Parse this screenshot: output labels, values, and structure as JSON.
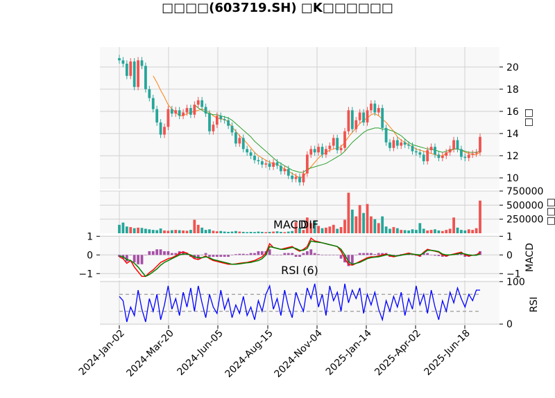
{
  "chart_data": {
    "type": "candlestick",
    "title": "□□□□(603719.SH) □K□□□□□□",
    "x_ticks": [
      "2024-Jan-02",
      "2024-Mar-20",
      "2024-Jun-05",
      "2024-Aug-15",
      "2024-Nov-04",
      "2025-Jan-14",
      "2025-Apr-02",
      "2025-Jun-18"
    ],
    "price_panel": {
      "ylabel": "□□",
      "yticks": [
        10,
        12,
        14,
        16,
        18,
        20
      ],
      "ylim": [
        9,
        21.8
      ],
      "candle_up_color": "#ef5350",
      "candle_down_color": "#26a69a",
      "ma_colors": [
        "#ff7f0e",
        "#2ca02c"
      ],
      "close": [
        20.6,
        20.3,
        19.2,
        20.5,
        18.2,
        20.6,
        20.1,
        18.0,
        17.2,
        16.2,
        15.0,
        13.9,
        14.6,
        16.2,
        15.8,
        16.1,
        15.6,
        15.9,
        16.3,
        15.7,
        16.6,
        17.0,
        16.4,
        15.8,
        14.2,
        14.8,
        15.6,
        15.3,
        15.2,
        14.7,
        14.1,
        13.1,
        13.6,
        12.6,
        12.3,
        12.0,
        11.6,
        11.5,
        11.2,
        11.3,
        11.0,
        11.4,
        11.1,
        10.6,
        10.8,
        10.2,
        9.9,
        10.1,
        9.6,
        10.4,
        12.1,
        12.6,
        12.3,
        12.8,
        12.1,
        12.6,
        12.9,
        13.6,
        12.5,
        12.7,
        14.2,
        16.1,
        14.4,
        15.2,
        15.9,
        15.0,
        16.1,
        16.7,
        15.9,
        16.3,
        14.5,
        13.2,
        12.7,
        13.4,
        12.9,
        13.2,
        13.0,
        12.9,
        12.4,
        12.3,
        12.1,
        11.5,
        12.5,
        12.8,
        12.1,
        11.8,
        12.0,
        12.3,
        12.6,
        13.4,
        12.6,
        11.9,
        11.8,
        12.1,
        12.2,
        12.3,
        13.7
      ],
      "ma_short": [
        null,
        null,
        null,
        null,
        null,
        null,
        null,
        null,
        null,
        19.2,
        18.6,
        17.9,
        17.3,
        16.6,
        16.2,
        15.9,
        15.6,
        15.6,
        15.8,
        15.9,
        16.0,
        16.1,
        16.2,
        16.1,
        15.9,
        15.6,
        15.4,
        15.3,
        15.3,
        15.0,
        14.6,
        14.2,
        13.8,
        13.5,
        13.1,
        12.7,
        12.3,
        12.0,
        11.8,
        11.6,
        11.4,
        11.3,
        11.2,
        11.0,
        10.8,
        10.6,
        10.4,
        10.2,
        10.0,
        10.1,
        10.6,
        11.0,
        11.4,
        11.8,
        12.1,
        12.3,
        12.5,
        12.6,
        12.7,
        12.8,
        13.2,
        13.7,
        14.1,
        14.5,
        14.9,
        15.2,
        15.4,
        15.7,
        15.8,
        15.6,
        15.3,
        15.0,
        14.6,
        14.2,
        13.7,
        13.4,
        13.2,
        13.0,
        12.8,
        12.6,
        12.5,
        12.4,
        12.3,
        12.2,
        12.1,
        12.0,
        12.0,
        12.2,
        12.4,
        12.6,
        12.6,
        12.5,
        12.3,
        12.2,
        12.1,
        12.1,
        12.3
      ],
      "ma_long": [
        null,
        null,
        null,
        null,
        null,
        null,
        null,
        null,
        null,
        null,
        null,
        null,
        null,
        null,
        null,
        null,
        null,
        null,
        null,
        null,
        16.6,
        16.3,
        16.1,
        15.9,
        15.8,
        15.7,
        15.7,
        15.6,
        15.5,
        15.4,
        15.2,
        14.9,
        14.6,
        14.3,
        14.0,
        13.7,
        13.3,
        13.0,
        12.7,
        12.4,
        12.1,
        11.8,
        11.5,
        11.3,
        11.1,
        10.9,
        10.7,
        10.6,
        10.5,
        10.5,
        10.8,
        10.9,
        11.0,
        11.1,
        11.2,
        11.3,
        11.5,
        11.7,
        11.9,
        12.1,
        12.4,
        12.8,
        13.2,
        13.5,
        13.8,
        14.1,
        14.3,
        14.4,
        14.5,
        14.5,
        14.4,
        14.4,
        14.3,
        14.2,
        14.0,
        13.8,
        13.5,
        13.2,
        13.0,
        12.9,
        12.8,
        12.7,
        12.6,
        12.6,
        12.5,
        12.4,
        12.3,
        12.4,
        12.5,
        12.6,
        12.6,
        12.5,
        12.4,
        12.3,
        12.3,
        12.3,
        12.4
      ]
    },
    "volume_panel": {
      "ylabel": "□□□",
      "yticks": [
        250000,
        500000,
        750000
      ],
      "ylim": [
        0,
        750000
      ],
      "values": [
        150000,
        190000,
        120000,
        110000,
        90000,
        100000,
        95000,
        80000,
        70000,
        60000,
        55000,
        85000,
        50000,
        45000,
        55000,
        60000,
        55000,
        50000,
        45000,
        60000,
        240000,
        150000,
        100000,
        60000,
        70000,
        45000,
        35000,
        40000,
        30000,
        25000,
        30000,
        40000,
        30000,
        25000,
        20000,
        25000,
        22000,
        30000,
        25000,
        20000,
        25000,
        30000,
        35000,
        25000,
        20000,
        30000,
        40000,
        200000,
        90000,
        60000,
        280000,
        180000,
        220000,
        130000,
        90000,
        100000,
        120000,
        150000,
        80000,
        110000,
        240000,
        720000,
        420000,
        300000,
        500000,
        360000,
        520000,
        300000,
        250000,
        180000,
        300000,
        120000,
        80000,
        110000,
        90000,
        60000,
        55000,
        50000,
        70000,
        60000,
        180000,
        80000,
        50000,
        60000,
        70000,
        50000,
        40000,
        60000,
        80000,
        280000,
        100000,
        60000,
        50000,
        70000,
        60000,
        90000,
        580000
      ]
    },
    "macd_panel": {
      "ylabel": "MACD",
      "labels": [
        "MACD",
        "DIF"
      ],
      "yticks": [
        -1,
        0,
        1
      ],
      "ylim": [
        -1.25,
        1.05
      ],
      "colors": {
        "dif": "#ff0000",
        "dea": "#008000",
        "hist": "#8b1a8b"
      },
      "dif": [
        -0.1,
        -0.2,
        -0.45,
        -0.3,
        -0.65,
        -0.9,
        -1.15,
        -1.15,
        -0.95,
        -0.8,
        -0.6,
        -0.4,
        -0.3,
        -0.2,
        -0.15,
        -0.05,
        0.1,
        0.15,
        0.1,
        -0.05,
        -0.2,
        -0.25,
        -0.15,
        -0.05,
        -0.2,
        -0.3,
        -0.35,
        -0.4,
        -0.45,
        -0.5,
        -0.5,
        -0.48,
        -0.45,
        -0.42,
        -0.4,
        -0.35,
        -0.3,
        -0.2,
        -0.1,
        0.1,
        0.6,
        0.4,
        0.35,
        0.3,
        0.35,
        0.4,
        0.45,
        0.3,
        0.2,
        0.3,
        0.45,
        0.9,
        0.75,
        0.7,
        0.65,
        0.6,
        0.55,
        0.5,
        0.45,
        0.2,
        -0.2,
        -0.5,
        -0.55,
        -0.45,
        -0.35,
        -0.25,
        -0.15,
        -0.1,
        -0.1,
        -0.05,
        0.0,
        0.05,
        -0.05,
        -0.1,
        -0.05,
        0.0,
        0.05,
        0.1,
        0.05,
        0.0,
        -0.05,
        0.15,
        0.3,
        0.25,
        0.2,
        0.15,
        0.0,
        -0.05,
        0.0,
        0.05,
        0.1,
        0.15,
        0.0,
        -0.05,
        -0.02,
        0.0,
        0.15
      ],
      "dea": [
        -0.05,
        -0.1,
        -0.25,
        -0.3,
        -0.45,
        -0.65,
        -0.9,
        -1.15,
        -1.05,
        -0.9,
        -0.75,
        -0.55,
        -0.4,
        -0.3,
        -0.2,
        -0.1,
        0.0,
        0.05,
        0.05,
        0.0,
        -0.1,
        -0.15,
        -0.15,
        -0.1,
        -0.15,
        -0.25,
        -0.3,
        -0.35,
        -0.4,
        -0.45,
        -0.5,
        -0.5,
        -0.48,
        -0.45,
        -0.42,
        -0.4,
        -0.35,
        -0.3,
        -0.2,
        0.0,
        0.45,
        0.4,
        0.35,
        0.3,
        0.3,
        0.35,
        0.4,
        0.35,
        0.25,
        0.25,
        0.35,
        0.75,
        0.7,
        0.68,
        0.65,
        0.6,
        0.55,
        0.5,
        0.45,
        0.3,
        0.0,
        -0.35,
        -0.5,
        -0.45,
        -0.4,
        -0.3,
        -0.2,
        -0.15,
        -0.12,
        -0.1,
        -0.05,
        0.0,
        0.0,
        -0.05,
        -0.05,
        -0.02,
        0.02,
        0.05,
        0.05,
        0.02,
        0.0,
        0.1,
        0.25,
        0.25,
        0.22,
        0.18,
        0.05,
        0.0,
        0.0,
        0.02,
        0.05,
        0.1,
        0.05,
        0.0,
        -0.02,
        -0.02,
        0.05
      ],
      "hist": [
        -0.1,
        -0.2,
        -0.35,
        0.0,
        -0.4,
        -0.5,
        -0.5,
        0.0,
        0.2,
        0.2,
        0.3,
        0.3,
        0.2,
        0.2,
        0.1,
        0.1,
        0.2,
        0.2,
        0.1,
        -0.1,
        -0.2,
        -0.2,
        0.0,
        0.1,
        -0.1,
        -0.1,
        -0.1,
        -0.1,
        -0.1,
        -0.1,
        0.0,
        0.04,
        0.06,
        0.06,
        0.04,
        0.1,
        0.1,
        0.2,
        0.2,
        0.2,
        0.3,
        0.0,
        0.0,
        0.0,
        0.1,
        0.1,
        0.1,
        -0.1,
        -0.1,
        0.1,
        0.2,
        0.3,
        0.1,
        0.04,
        0.0,
        0.0,
        0.0,
        0.0,
        0.0,
        -0.2,
        -0.4,
        -0.6,
        -0.5,
        0.0,
        0.1,
        0.1,
        0.1,
        0.1,
        0.04,
        0.1,
        0.1,
        0.1,
        -0.1,
        -0.1,
        0.0,
        0.04,
        0.06,
        0.1,
        0.0,
        -0.04,
        -0.1,
        0.1,
        0.1,
        0.0,
        -0.04,
        -0.06,
        -0.1,
        -0.1,
        0.0,
        0.06,
        0.1,
        0.1,
        -0.1,
        -0.1,
        0.0,
        0.04,
        0.2
      ]
    },
    "rsi_panel": {
      "ylabel": "RSI",
      "label": "RSI (6)",
      "yticks": [
        0,
        100
      ],
      "ylim": [
        -3,
        103
      ],
      "overbought": 70,
      "oversold": 30,
      "line_color": "#0000ff",
      "values": [
        65,
        55,
        5,
        40,
        20,
        80,
        35,
        5,
        60,
        30,
        70,
        10,
        45,
        90,
        35,
        60,
        20,
        75,
        40,
        85,
        30,
        90,
        50,
        15,
        70,
        40,
        25,
        80,
        35,
        60,
        15,
        45,
        25,
        65,
        20,
        40,
        10,
        55,
        30,
        70,
        90,
        35,
        60,
        20,
        80,
        40,
        15,
        75,
        50,
        30,
        85,
        60,
        95,
        40,
        70,
        20,
        90,
        55,
        75,
        30,
        95,
        50,
        80,
        60,
        85,
        25,
        70,
        45,
        75,
        35,
        10,
        55,
        30,
        65,
        40,
        75,
        20,
        60,
        35,
        90,
        45,
        70,
        25,
        80,
        40,
        10,
        55,
        30,
        75,
        50,
        85,
        60,
        40,
        70,
        55,
        80,
        80
      ]
    }
  }
}
